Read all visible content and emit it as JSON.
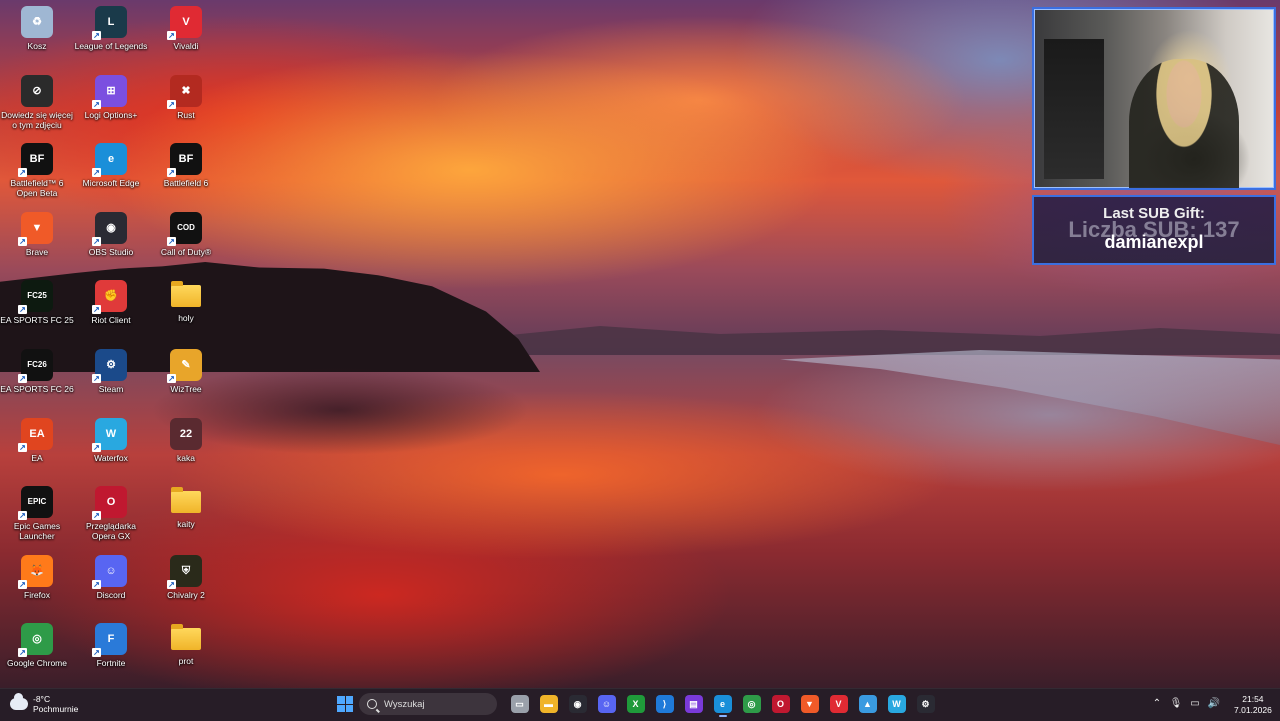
{
  "desktop_icons": [
    {
      "label": "Kosz",
      "icon": "recycle-bin-icon",
      "color": "#9fb7d3",
      "glyph": "♻",
      "shortcut": false
    },
    {
      "label": "League of Legends",
      "icon": "league-of-legends-icon",
      "color": "#1a3a4a",
      "glyph": "L",
      "shortcut": true
    },
    {
      "label": "Vivaldi",
      "icon": "vivaldi-icon",
      "color": "#e02a33",
      "glyph": "V",
      "shortcut": true
    },
    {
      "label": "Dowiedz się więcej o tym zdjęciu",
      "icon": "learn-about-picture-icon",
      "color": "#2b2b2b",
      "glyph": "⊘",
      "shortcut": false
    },
    {
      "label": "Logi Options+",
      "icon": "logi-options-icon",
      "color": "#7b4fe0",
      "glyph": "⊞",
      "shortcut": true
    },
    {
      "label": "Rust",
      "icon": "rust-icon",
      "color": "#b32a20",
      "glyph": "✖",
      "shortcut": true
    },
    {
      "label": "Battlefield™ 6 Open Beta",
      "icon": "battlefield-icon",
      "color": "#111111",
      "glyph": "BF",
      "shortcut": true
    },
    {
      "label": "Microsoft Edge",
      "icon": "edge-icon",
      "color": "#1a8fd9",
      "glyph": "e",
      "shortcut": true
    },
    {
      "label": "Battlefield 6",
      "icon": "battlefield-icon",
      "color": "#111111",
      "glyph": "BF",
      "shortcut": true
    },
    {
      "label": "Brave",
      "icon": "brave-icon",
      "color": "#f05a28",
      "glyph": "▼",
      "shortcut": true
    },
    {
      "label": "OBS Studio",
      "icon": "obs-icon",
      "color": "#2a2a33",
      "glyph": "◉",
      "shortcut": true
    },
    {
      "label": "Call of Duty®",
      "icon": "call-of-duty-icon",
      "color": "#111111",
      "glyph": "COD",
      "shortcut": true
    },
    {
      "label": "EA SPORTS FC 25",
      "icon": "ea-fc25-icon",
      "color": "#0d1a10",
      "glyph": "FC25",
      "shortcut": true
    },
    {
      "label": "Riot Client",
      "icon": "riot-client-icon",
      "color": "#e03a3a",
      "glyph": "✊",
      "shortcut": true
    },
    {
      "label": "holy",
      "icon": "folder-icon",
      "color": "#f0b429",
      "glyph": "",
      "shortcut": false,
      "folder": true
    },
    {
      "label": "EA SPORTS FC 26",
      "icon": "ea-fc26-icon",
      "color": "#111111",
      "glyph": "FC26",
      "shortcut": true
    },
    {
      "label": "Steam",
      "icon": "steam-icon",
      "color": "#1b4a8a",
      "glyph": "⚙",
      "shortcut": true
    },
    {
      "label": "WizTree",
      "icon": "wiztree-icon",
      "color": "#e8a52a",
      "glyph": "✎",
      "shortcut": true
    },
    {
      "label": "EA",
      "icon": "ea-icon",
      "color": "#e0451f",
      "glyph": "EA",
      "shortcut": true
    },
    {
      "label": "Waterfox",
      "icon": "waterfox-icon",
      "color": "#29a8e0",
      "glyph": "W",
      "shortcut": true
    },
    {
      "label": "kaka",
      "icon": "kaka-file-icon",
      "color": "#5a2a30",
      "glyph": "22",
      "shortcut": false
    },
    {
      "label": "Epic Games Launcher",
      "icon": "epic-games-icon",
      "color": "#111111",
      "glyph": "EPIC",
      "shortcut": true
    },
    {
      "label": "Przeglądarka Opera GX",
      "icon": "opera-gx-icon",
      "color": "#c01830",
      "glyph": "O",
      "shortcut": true
    },
    {
      "label": "kaity",
      "icon": "folder-icon",
      "color": "#f0b429",
      "glyph": "",
      "shortcut": false,
      "folder": true
    },
    {
      "label": "Firefox",
      "icon": "firefox-icon",
      "color": "#ff7a1a",
      "glyph": "🦊",
      "shortcut": true
    },
    {
      "label": "Discord",
      "icon": "discord-icon",
      "color": "#5865f2",
      "glyph": "☺",
      "shortcut": true
    },
    {
      "label": "Chivalry 2",
      "icon": "chivalry-2-icon",
      "color": "#2a2a1a",
      "glyph": "⛨",
      "shortcut": true
    },
    {
      "label": "Google Chrome",
      "icon": "chrome-icon",
      "color": "#2e9b48",
      "glyph": "◎",
      "shortcut": true
    },
    {
      "label": "Fortnite",
      "icon": "fortnite-icon",
      "color": "#2a7ad9",
      "glyph": "F",
      "shortcut": true
    },
    {
      "label": "prot",
      "icon": "folder-icon",
      "color": "#f0b429",
      "glyph": "",
      "shortcut": false,
      "folder": true
    }
  ],
  "overlay": {
    "sub_gift_line1": "Last SUB Gift:",
    "sub_gift_counter": "Liczba SUB: 137",
    "sub_gift_name": "damianexpl"
  },
  "taskbar": {
    "weather_temp": "-8°C",
    "weather_desc": "Pochmurnie",
    "search_placeholder": "Wyszukaj",
    "apps": [
      {
        "icon": "task-view-icon",
        "color": "#9aa0aa",
        "glyph": "▭"
      },
      {
        "icon": "file-explorer-icon",
        "color": "#f0b429",
        "glyph": "▬"
      },
      {
        "icon": "obs-icon",
        "color": "#2a2a33",
        "glyph": "◉"
      },
      {
        "icon": "discord-icon",
        "color": "#5865f2",
        "glyph": "☺"
      },
      {
        "icon": "xbox-icon",
        "color": "#1f9a3a",
        "glyph": "X"
      },
      {
        "icon": "vscode-icon",
        "color": "#1f7ad9",
        "glyph": "⟩"
      },
      {
        "icon": "clapper-icon",
        "color": "#7a3ad9",
        "glyph": "▤"
      },
      {
        "icon": "edge-icon",
        "color": "#1a8fd9",
        "glyph": "e",
        "active": true
      },
      {
        "icon": "chrome-icon",
        "color": "#2e9b48",
        "glyph": "◎"
      },
      {
        "icon": "opera-gx-icon",
        "color": "#c01830",
        "glyph": "O"
      },
      {
        "icon": "brave-icon",
        "color": "#f05a28",
        "glyph": "▼"
      },
      {
        "icon": "vivaldi-icon",
        "color": "#e02a33",
        "glyph": "V"
      },
      {
        "icon": "photos-icon",
        "color": "#3a9ae0",
        "glyph": "▲"
      },
      {
        "icon": "waterfox-icon",
        "color": "#29a8e0",
        "glyph": "W"
      },
      {
        "icon": "steam-icon",
        "color": "#2a2a33",
        "glyph": "⚙"
      }
    ],
    "clock_time": "21:54",
    "clock_date": "7.01.2026"
  }
}
